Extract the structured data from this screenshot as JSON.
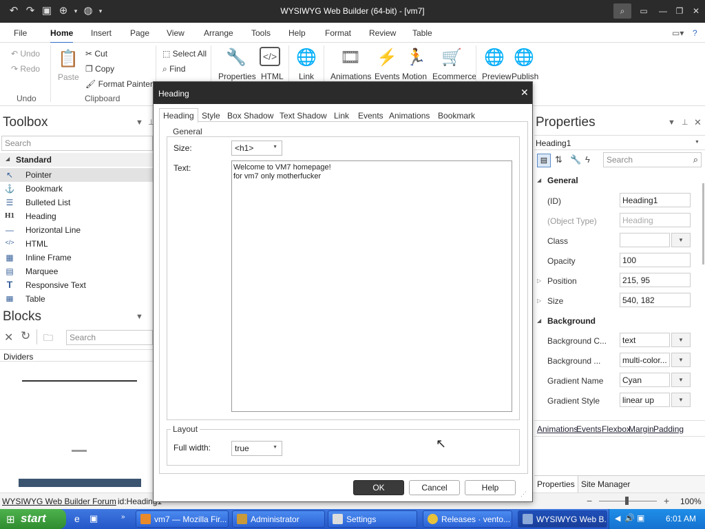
{
  "app": {
    "window_title": "WYSIWYG Web Builder (64-bit) - [vm7]"
  },
  "menu": [
    "File",
    "Home",
    "Insert",
    "Page",
    "View",
    "Arrange",
    "Tools",
    "Help",
    "Format",
    "Review",
    "Table"
  ],
  "ribbon": {
    "undo": "Undo",
    "redo": "Redo",
    "undo_group": "Undo",
    "paste": "Paste",
    "cut": "Cut",
    "copy": "Copy",
    "format_painter": "Format Painter",
    "clipboard_group": "Clipboard",
    "select_all": "Select All",
    "find": "Find",
    "properties": "Properties",
    "html": "HTML",
    "link": "Link",
    "animations": "Animations",
    "events": "Events",
    "motion": "Motion",
    "ecommerce": "Ecommerce",
    "preview": "Preview",
    "publish": "Publish"
  },
  "toolbox": {
    "title": "Toolbox",
    "search_placeholder": "Search",
    "category": "Standard",
    "items": [
      {
        "label": "Pointer",
        "icon": "↖"
      },
      {
        "label": "Bookmark",
        "icon": "⚓"
      },
      {
        "label": "Bulleted List",
        "icon": "☰"
      },
      {
        "label": "Heading",
        "icon": "H1"
      },
      {
        "label": "Horizontal Line",
        "icon": "—"
      },
      {
        "label": "HTML",
        "icon": "</>"
      },
      {
        "label": "Inline Frame",
        "icon": "▦"
      },
      {
        "label": "Marquee",
        "icon": "▤"
      },
      {
        "label": "Responsive Text",
        "icon": "T"
      },
      {
        "label": "Table",
        "icon": "▦"
      }
    ]
  },
  "blocks": {
    "title": "Blocks",
    "search_placeholder": "Search",
    "category": "Dividers"
  },
  "properties": {
    "title": "Properties",
    "object": "Heading1",
    "search_placeholder": "Search",
    "general_section": "General",
    "background_section": "Background",
    "rows": [
      {
        "label": "(ID)",
        "value": "Heading1"
      },
      {
        "label": "(Object Type)",
        "value": "Heading"
      },
      {
        "label": "Class",
        "value": ""
      },
      {
        "label": "Opacity",
        "value": "100"
      },
      {
        "label": "Position",
        "value": "215, 95"
      },
      {
        "label": "Size",
        "value": "540, 182"
      }
    ],
    "bg_rows": [
      {
        "label": "Background C...",
        "value": "text"
      },
      {
        "label": "Background ...",
        "value": "multi-color..."
      },
      {
        "label": "Gradient Name",
        "value": "Cyan"
      },
      {
        "label": "Gradient Style",
        "value": "linear up"
      }
    ],
    "links": [
      "Animations",
      "Events",
      "Flexbox",
      "Margin",
      "Padding"
    ],
    "tabs": [
      "Properties",
      "Site Manager"
    ]
  },
  "dialog": {
    "title": "Heading",
    "tabs": [
      "Heading",
      "Style",
      "Box Shadow",
      "Text Shadow",
      "Link",
      "Events",
      "Animations",
      "Bookmark"
    ],
    "general_legend": "General",
    "size_label": "Size:",
    "size_value": "<h1>",
    "text_label": "Text:",
    "text_line1": "Welcome to VM7 homepage!",
    "text_line2": "for vm7 only motherfucker",
    "layout_legend": "Layout",
    "fullwidth_label": "Full width:",
    "fullwidth_value": "true",
    "ok": "OK",
    "cancel": "Cancel",
    "help": "Help"
  },
  "statusbar": {
    "forum": "WYSIWYG Web Builder Forum",
    "id": "id:Heading1",
    "zoom": "100%"
  },
  "taskbar": {
    "start": "start",
    "tasks": [
      "vm7 — Mozilla Fir...",
      "Administrator",
      "Settings",
      "Releases · vento...",
      "WYSIWYG Web B..."
    ],
    "clock": "6:01 AM"
  },
  "colors": {
    "accent": "#2d6bc6",
    "titlebar": "#2b2b2b",
    "taskbar": "#2457c8",
    "start": "#3c9a3c"
  }
}
